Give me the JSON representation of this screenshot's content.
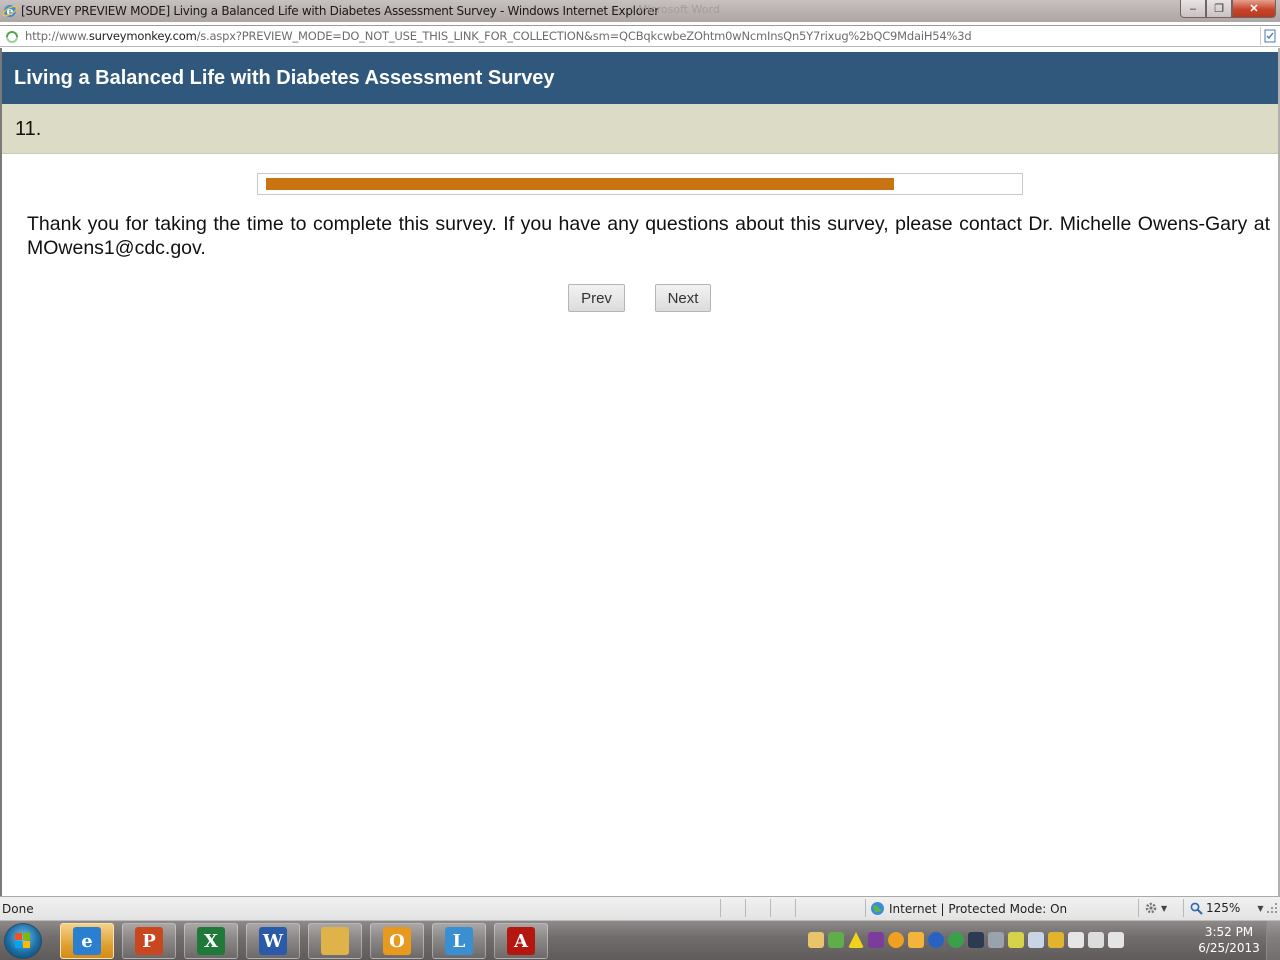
{
  "window": {
    "title": "[SURVEY PREVIEW MODE] Living a Balanced Life with Diabetes Assessment Survey - Windows Internet Explorer",
    "ghost_title": "Microsoft Word",
    "minimize": "–",
    "restore": "❐",
    "close": "✕"
  },
  "address": {
    "url_prefix": "http://www.",
    "url_domain": "surveymonkey.com",
    "url_path": "/s.aspx?PREVIEW_MODE=DO_NOT_USE_THIS_LINK_FOR_COLLECTION&sm=QCBqkcwbeZOhtm0wNcmInsQn5Y7rixug%2bQC9MdaiH54%3d"
  },
  "survey": {
    "title": "Living a Balanced Life with Diabetes Assessment Survey",
    "question_number": "11.",
    "progress_fraction": 0.84,
    "message": "Thank you for taking the time to complete this survey. If you have any questions about this survey, please contact Dr. Michelle Owens-Gary at MOwens1@cdc.gov.",
    "prev_label": "Prev",
    "next_label": "Next"
  },
  "colors": {
    "header_bg": "#30587d",
    "question_bar_bg": "#dbdbc6",
    "progress_fill": "#c87413"
  },
  "statusbar": {
    "status": "Done",
    "zone": "Internet | Protected Mode: On",
    "zoom": "125%"
  },
  "taskbar": {
    "apps": [
      {
        "name": "internet-explorer",
        "glyph": "e",
        "color": "#2a7fd1",
        "active": true
      },
      {
        "name": "powerpoint",
        "glyph": "P",
        "color": "#c9471f",
        "active": false
      },
      {
        "name": "excel",
        "glyph": "X",
        "color": "#1f7a3a",
        "active": false
      },
      {
        "name": "word",
        "glyph": "W",
        "color": "#2a5aa8",
        "active": false
      },
      {
        "name": "file-explorer",
        "glyph": "",
        "color": "#e0b24a",
        "active": false
      },
      {
        "name": "outlook",
        "glyph": "O",
        "color": "#e89a1e",
        "active": false
      },
      {
        "name": "lync",
        "glyph": "L",
        "color": "#3a8fd0",
        "active": false
      },
      {
        "name": "adobe-reader",
        "glyph": "A",
        "color": "#b3170f",
        "active": false
      }
    ],
    "time": "3:52 PM",
    "date": "6/25/2013"
  }
}
